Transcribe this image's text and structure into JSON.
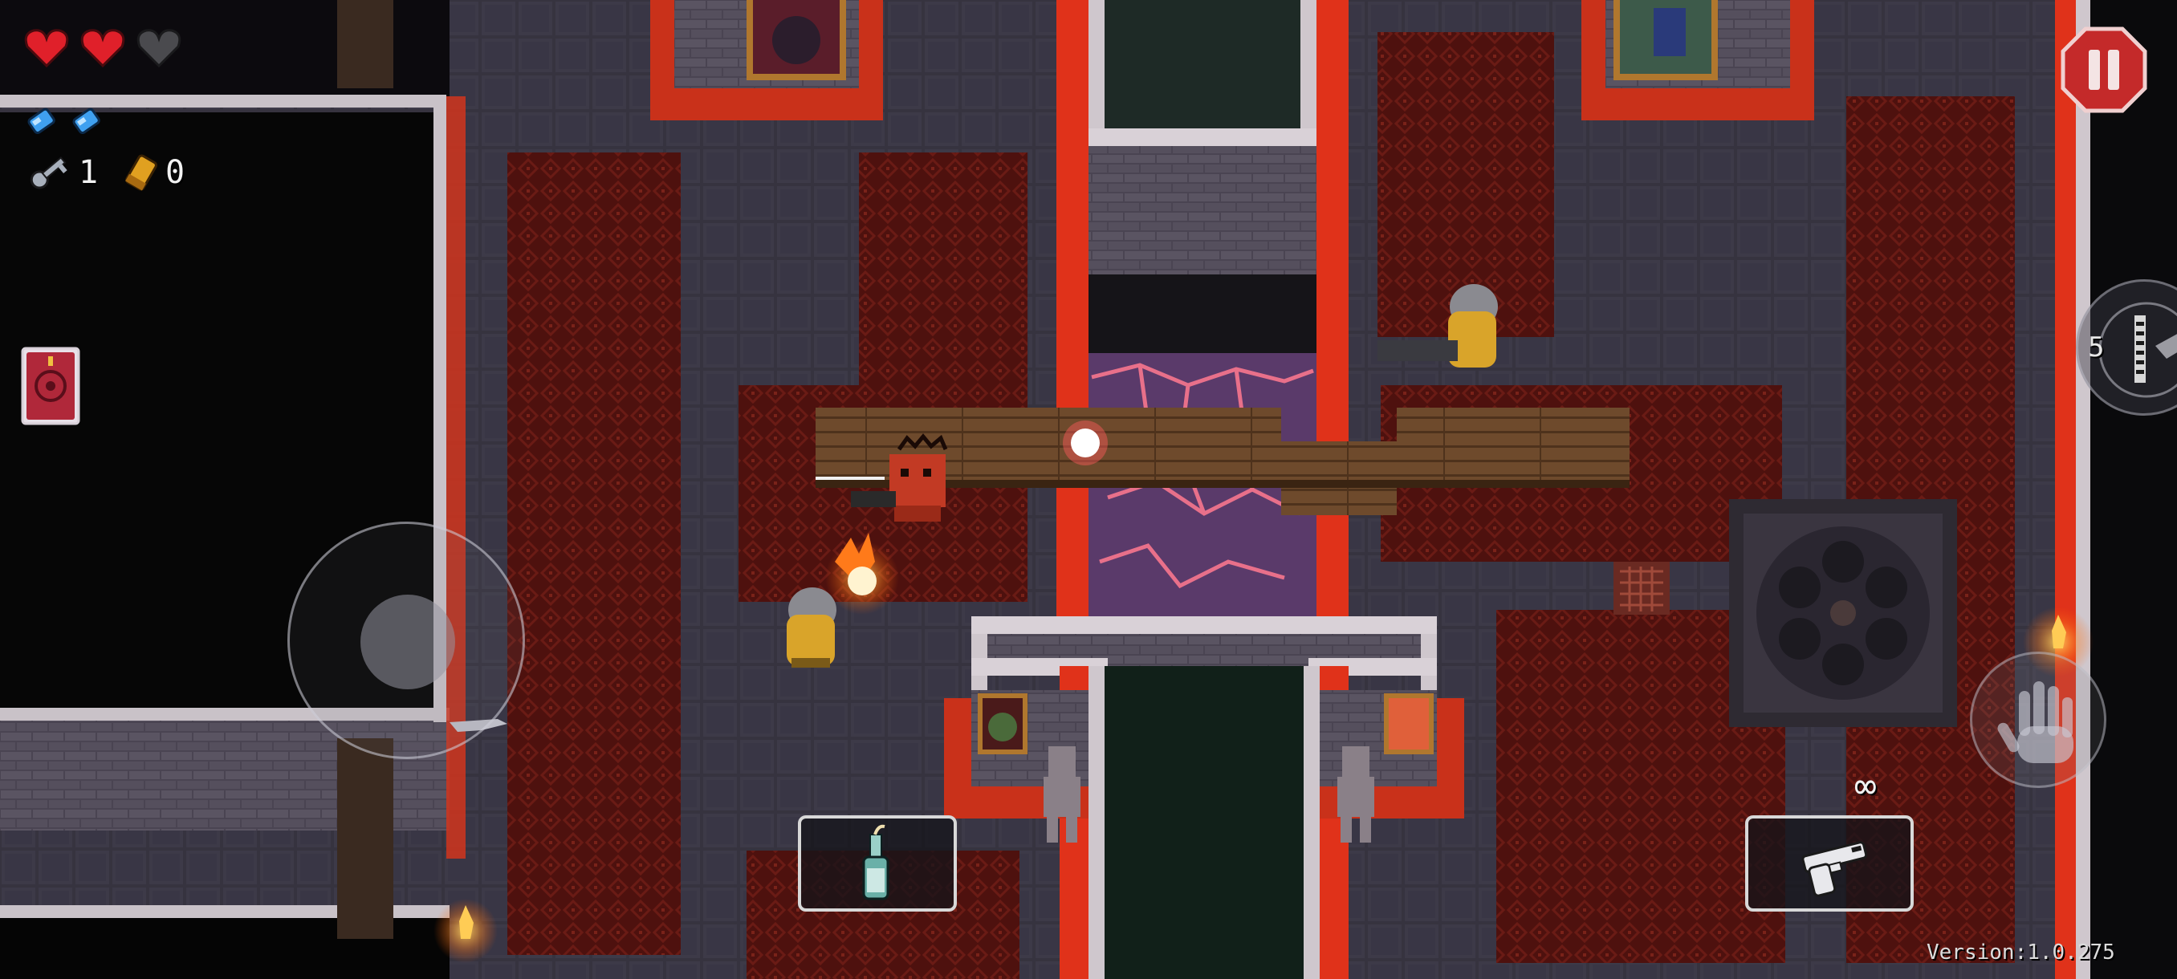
{
  "hud": {
    "hearts": {
      "full": 2,
      "empty": 1
    },
    "blanks": 2,
    "keys": {
      "icon": "key-icon",
      "count": "1"
    },
    "shells": {
      "icon": "shell-currency-icon",
      "count": "0"
    },
    "active_item": "blank-spellbook-icon",
    "pause": "pause-icon",
    "interact": "hand-icon",
    "gun_swap": {
      "icon": "gun-swap-icon",
      "ammo_label": "5"
    },
    "item_slot": {
      "icon": "molotov-bottle-icon"
    },
    "gun_slot": {
      "icon": "rusty-sidearm-icon",
      "ammo": "∞"
    },
    "version": "Version:1.0.275"
  },
  "colors": {
    "floor": "#3b3846",
    "carpet": "#5a1410",
    "wall_glow": "#e0321a",
    "heart": "#e0202a",
    "blank": "#3fa0f0"
  }
}
